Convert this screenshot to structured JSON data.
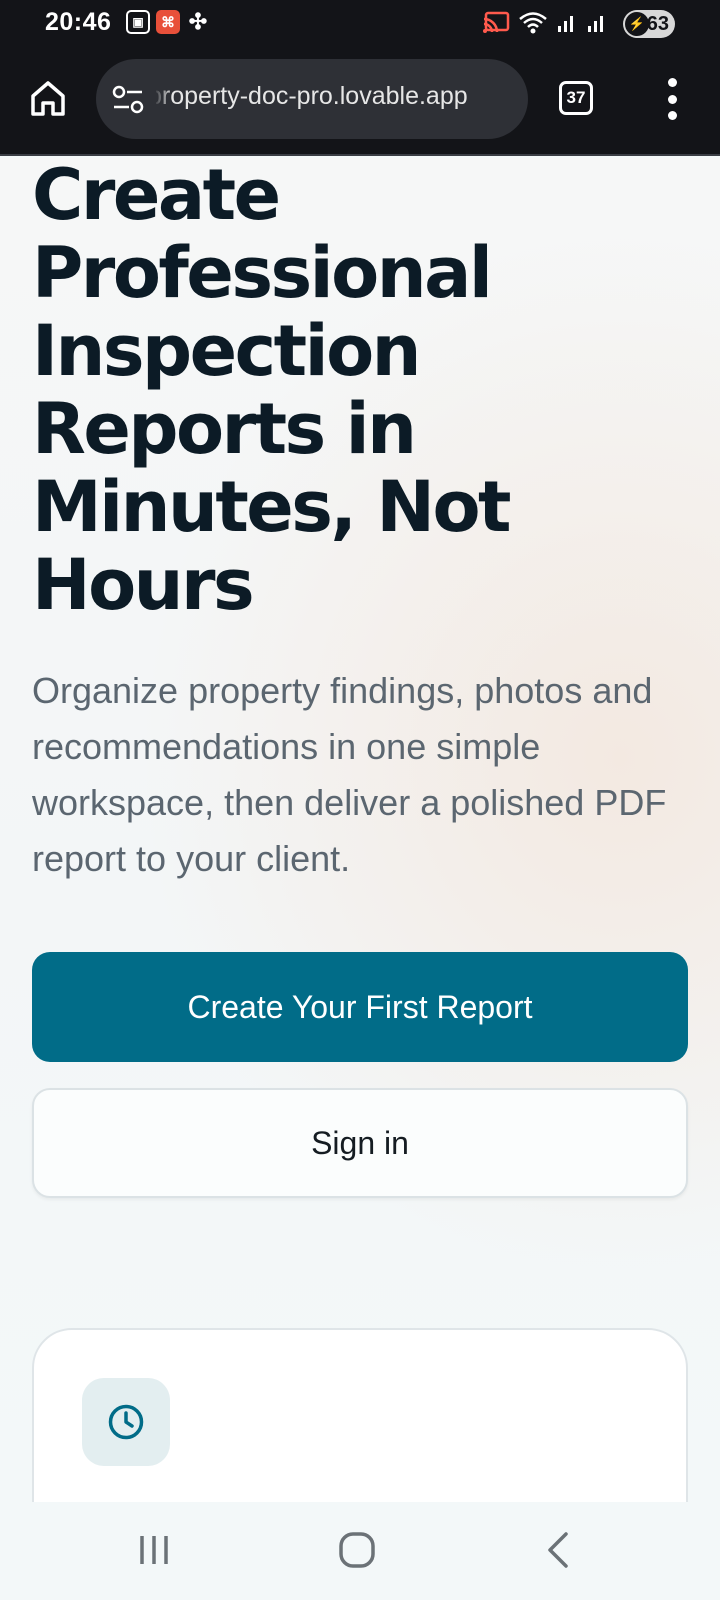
{
  "status_bar": {
    "time": "20:46",
    "battery_level": "63",
    "notification_icons": [
      "screenshot-icon",
      "app-notification-icon",
      "pinwheel-icon"
    ],
    "system_icons": [
      "cast-icon",
      "wifi-icon",
      "signal-icon",
      "signal-icon",
      "battery-icon"
    ]
  },
  "browser": {
    "url": "property-doc-pro.lovable.app",
    "tab_count": "37",
    "icons": [
      "home-icon",
      "site-settings-icon",
      "tabs-icon",
      "more-menu-icon"
    ]
  },
  "hero": {
    "title": "Create Professional Inspection Reports in Minutes, Not Hours",
    "subtitle": "Organize property findings, photos and recommendations in one simple workspace, then deliver a polished PDF report to your client."
  },
  "actions": {
    "primary_label": "Create Your First Report",
    "secondary_label": "Sign in"
  },
  "feature_card": {
    "icon": "clock-icon"
  },
  "colors": {
    "primary": "#016c88",
    "heading": "#0c1b26",
    "body_text": "#5b6670",
    "chrome": "#131418"
  },
  "nav_bar": {
    "buttons": [
      "recent-apps-icon",
      "home-icon",
      "back-icon"
    ]
  }
}
